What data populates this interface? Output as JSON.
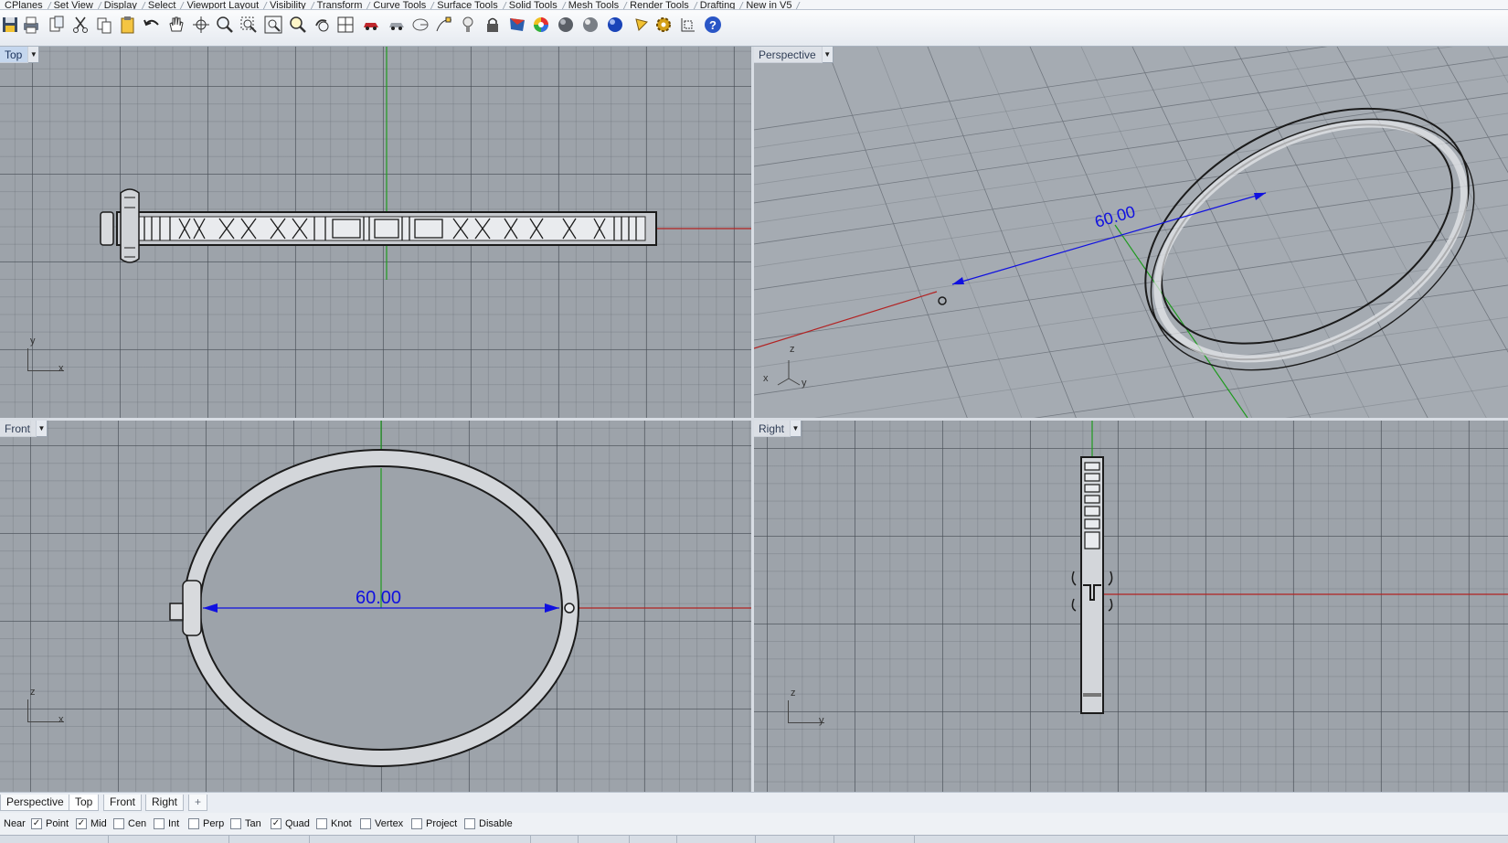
{
  "toolbar_tabs": [
    "CPlanes",
    "Set View",
    "Display",
    "Select",
    "Viewport Layout",
    "Visibility",
    "Transform",
    "Curve Tools",
    "Surface Tools",
    "Solid Tools",
    "Mesh Tools",
    "Render Tools",
    "Drafting",
    "New in V5"
  ],
  "toolbar_icons": [
    "save-icon",
    "print-icon",
    "copy-to-clipboard-icon",
    "cut-icon",
    "copy-icon",
    "paste-icon",
    "undo-icon",
    "pan-hand-icon",
    "rotate-view-icon",
    "zoom-dynamic-icon",
    "zoom-window-icon",
    "zoom-extents-icon",
    "zoom-selected-icon",
    "undo-view-icon",
    "four-viewports-icon",
    "car-options-icon",
    "car-select-icon",
    "ellipse-icon",
    "point-on-curve-icon",
    "light-bulb-icon",
    "lock-icon",
    "render-icon",
    "color-wheel-icon",
    "shaded-sphere-icon",
    "rendered-sphere-icon",
    "blue-sphere-icon",
    "pen-icon",
    "gear-options-icon",
    "dimension-tool-icon",
    "help-icon"
  ],
  "viewports": {
    "top": {
      "label": "Top",
      "axis_v": "y",
      "axis_h": "x"
    },
    "perspective": {
      "label": "Perspective",
      "dimension": "60.00",
      "axis_z": "z",
      "axis_x": "x",
      "axis_y": "y"
    },
    "front": {
      "label": "Front",
      "dimension": "60.00",
      "axis_v": "z",
      "axis_h": "x"
    },
    "right": {
      "label": "Right",
      "axis_v": "z",
      "axis_h": "y"
    }
  },
  "viewport_tabs": [
    {
      "label": "Perspective",
      "active": false
    },
    {
      "label": "Top",
      "active": true
    },
    {
      "label": "Front",
      "active": false
    },
    {
      "label": "Right",
      "active": false
    },
    {
      "label": "+",
      "active": false
    }
  ],
  "osnaps": [
    {
      "label": "Near",
      "checked": null
    },
    {
      "label": "Point",
      "checked": true
    },
    {
      "label": "Mid",
      "checked": true
    },
    {
      "label": "Cen",
      "checked": false
    },
    {
      "label": "Int",
      "checked": false
    },
    {
      "label": "Perp",
      "checked": false
    },
    {
      "label": "Tan",
      "checked": false
    },
    {
      "label": "Quad",
      "checked": true
    },
    {
      "label": "Knot",
      "checked": false
    },
    {
      "label": "Vertex",
      "checked": false
    },
    {
      "label": "Project",
      "checked": false
    },
    {
      "label": "Disable",
      "checked": false
    }
  ],
  "colors": {
    "x_axis": "#b22222",
    "y_axis": "#1f9a1f",
    "dimension": "#1010e0",
    "active_label": "#c5d7ee"
  }
}
